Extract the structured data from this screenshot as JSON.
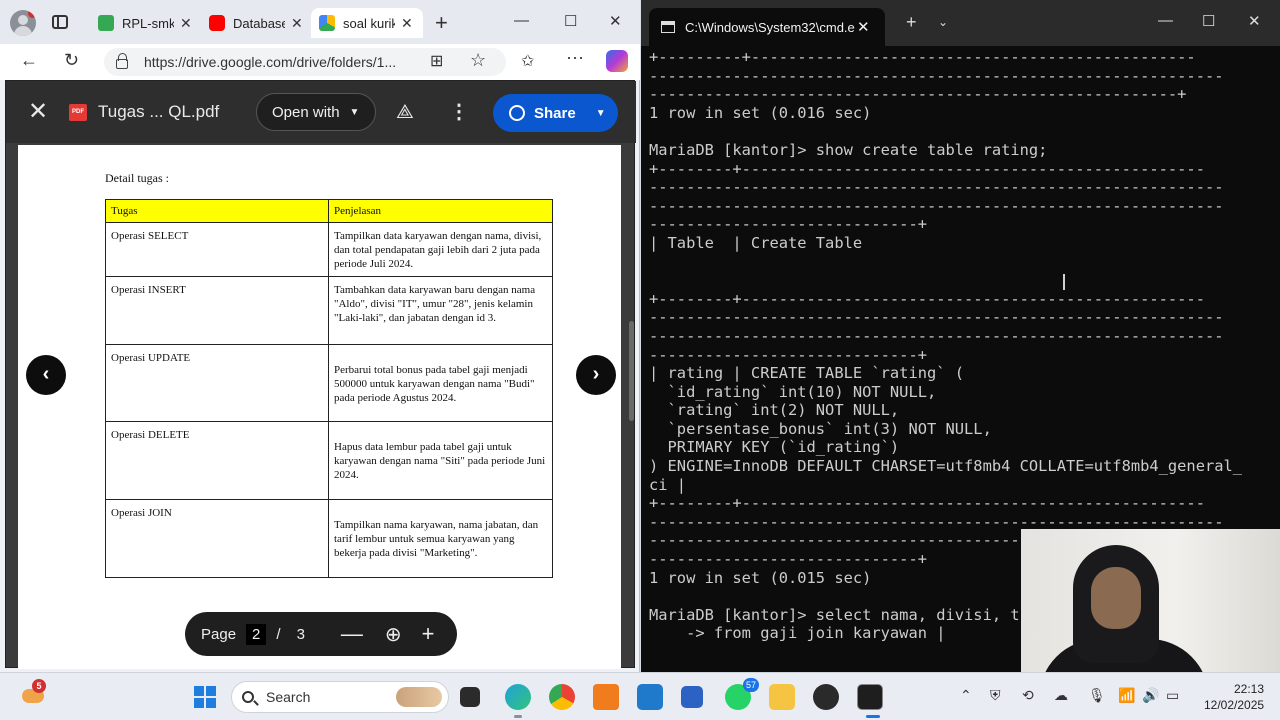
{
  "browser": {
    "tabs": [
      {
        "label": "RPL-smkn",
        "color": "#34a853"
      },
      {
        "label": "Database",
        "color": "#ff0000"
      },
      {
        "label": "soal kurik",
        "color": "#fbbc04"
      }
    ],
    "url": "https://drive.google.com/drive/folders/1..."
  },
  "viewer": {
    "file_title": "Tugas ... QL.pdf",
    "pdf_badge": "PDF",
    "open_with_label": "Open with",
    "share_label": "Share"
  },
  "document": {
    "heading": "Detail tugas :",
    "headers": [
      "Tugas",
      "Penjelasan"
    ],
    "rows": [
      {
        "task": "Operasi SELECT",
        "desc": "Tampilkan data karyawan dengan nama, divisi, dan total pendapatan gaji lebih dari 2 juta pada periode Juli 2024."
      },
      {
        "task": "Operasi INSERT",
        "desc": "Tambahkan data karyawan baru dengan nama \"Aldo\", divisi \"IT\", umur \"28\", jenis kelamin \"Laki-laki\", dan jabatan dengan id 3."
      },
      {
        "task": "Operasi UPDATE",
        "desc": "Perbarui total bonus pada tabel gaji menjadi 500000 untuk karyawan dengan nama \"Budi\" pada periode Agustus 2024."
      },
      {
        "task": "Operasi DELETE",
        "desc": "Hapus data lembur pada tabel gaji untuk karyawan dengan nama \"Siti\" pada periode Juni 2024."
      },
      {
        "task": "Operasi JOIN",
        "desc": "Tampilkan nama karyawan, nama jabatan, dan tarif lembur untuk semua karyawan yang bekerja pada divisi \"Marketing\"."
      }
    ]
  },
  "pager": {
    "label": "Page",
    "current": "2",
    "separator": "/",
    "total": "3"
  },
  "terminal": {
    "tab_title": "C:\\Windows\\System32\\cmd.e",
    "lines": [
      "+---------+------------------------------------------------",
      "--------------------------------------------------------------",
      "---------------------------------------------------------+",
      "1 row in set (0.016 sec)",
      "",
      "MariaDB [kantor]> show create table rating;",
      "+--------+--------------------------------------------------",
      "--------------------------------------------------------------",
      "--------------------------------------------------------------",
      "-----------------------------+",
      "| Table  | Create Table",
      "",
      "",
      "+--------+--------------------------------------------------",
      "--------------------------------------------------------------",
      "--------------------------------------------------------------",
      "-----------------------------+",
      "| rating | CREATE TABLE `rating` (",
      "  `id_rating` int(10) NOT NULL,",
      "  `rating` int(2) NOT NULL,",
      "  `persentase_bonus` int(3) NOT NULL,",
      "  PRIMARY KEY (`id_rating`)",
      ") ENGINE=InnoDB DEFAULT CHARSET=utf8mb4 COLLATE=utf8mb4_general_",
      "ci |",
      "+--------+--------------------------------------------------",
      "--------------------------------------------------------------",
      "--------------------------------------------------------------",
      "-----------------------------+",
      "1 row in set (0.015 sec)",
      "",
      "MariaDB [kantor]> select nama, divisi, t",
      "    -> from gaji join karyawan |"
    ]
  },
  "taskbar": {
    "weather_badge": "5",
    "search_label": "Search",
    "whatsapp_badge": "57",
    "time": "22:13",
    "date": "12/02/2025"
  }
}
